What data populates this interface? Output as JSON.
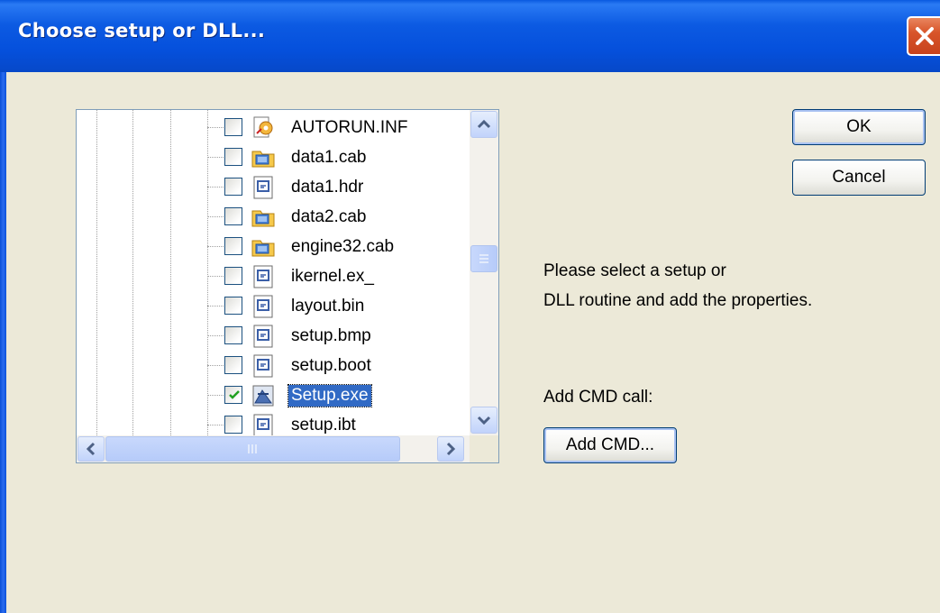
{
  "dialog": {
    "title": "Choose setup or DLL...",
    "close_icon": "close-icon"
  },
  "tree": {
    "items": [
      {
        "name": "AUTORUN.INF",
        "checked": false,
        "icon": "autorun-icon"
      },
      {
        "name": "data1.cab",
        "checked": false,
        "icon": "cab-folder-icon"
      },
      {
        "name": "data1.hdr",
        "checked": false,
        "icon": "generic-file-icon"
      },
      {
        "name": "data2.cab",
        "checked": false,
        "icon": "cab-folder-icon"
      },
      {
        "name": "engine32.cab",
        "checked": false,
        "icon": "cab-folder-icon"
      },
      {
        "name": "ikernel.ex_",
        "checked": false,
        "icon": "generic-file-icon"
      },
      {
        "name": "layout.bin",
        "checked": false,
        "icon": "generic-file-icon"
      },
      {
        "name": "setup.bmp",
        "checked": false,
        "icon": "generic-file-icon"
      },
      {
        "name": "setup.boot",
        "checked": false,
        "icon": "generic-file-icon"
      },
      {
        "name": "Setup.exe",
        "checked": true,
        "selected": true,
        "icon": "setup-exe-icon"
      },
      {
        "name": "setup.ibt",
        "checked": false,
        "icon": "generic-file-icon"
      }
    ]
  },
  "buttons": {
    "ok_label": "OK",
    "cancel_label": "Cancel",
    "add_cmd_label": "Add CMD..."
  },
  "info": {
    "line1": "Please select a setup or",
    "line2": "DLL routine and add the properties.",
    "add_cmd_caption": "Add CMD call:"
  },
  "colors": {
    "titlebar": "#0550dc",
    "window_bg": "#ece9d8",
    "selection": "#316ac5",
    "close_button": "#d8552a"
  }
}
